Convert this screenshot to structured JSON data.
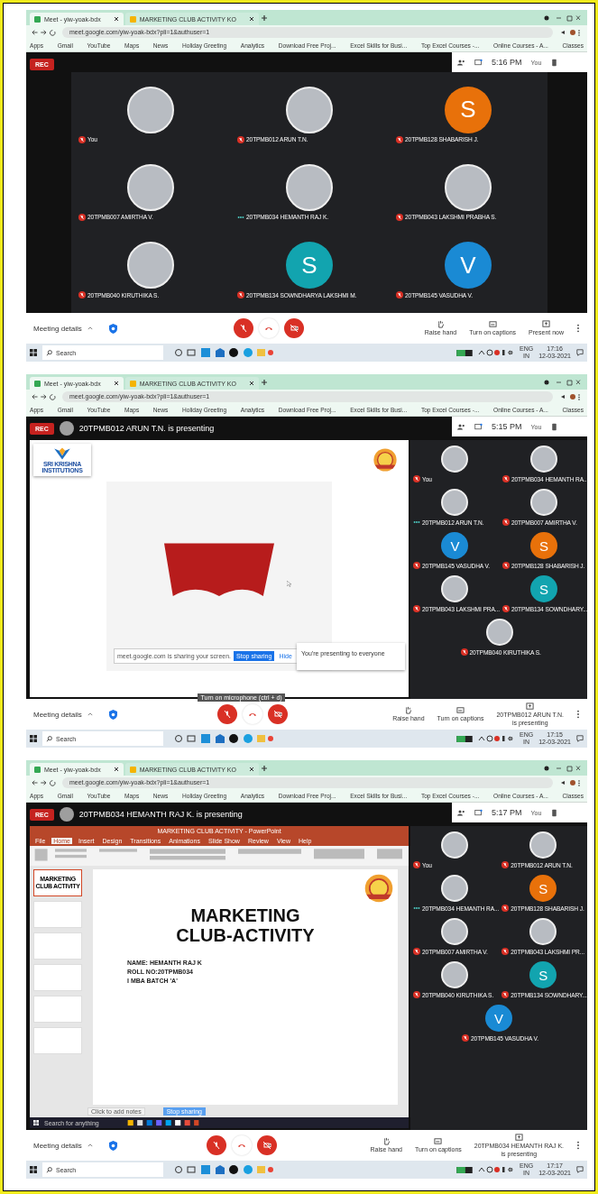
{
  "panels": [
    {
      "browser": {
        "tabs": [
          {
            "label": "Meet - yiw-yoak-bdx",
            "selected": true
          },
          {
            "label": "MARKETING CLUB ACTIVITY KO",
            "selected": false
          }
        ],
        "url": "meet.google.com/yiw-yoak-bdx?pli=1&authuser=1",
        "bookmarks": [
          "Apps",
          "Gmail",
          "YouTube",
          "Maps",
          "News",
          "Holiday Greeting",
          "Analytics",
          "Download Free Proj...",
          "Excel Skills for Busi...",
          "Top Excel Courses -...",
          "Online Courses - A...",
          "Classes"
        ]
      },
      "meeting": {
        "rec": "REC",
        "time": "5:16 PM",
        "you": "You",
        "tiles": [
          {
            "name": "You",
            "kind": "photo",
            "muted": true
          },
          {
            "name": "20TPMB012 ARUN T.N.",
            "kind": "photo",
            "muted": true
          },
          {
            "name": "20TPMB128 SHABARISH J.",
            "kind": "letter",
            "letter": "S",
            "color": "#e8710a",
            "muted": true
          },
          {
            "name": "20TPMB007 AMIRTHA V.",
            "kind": "photo",
            "muted": true
          },
          {
            "name": "20TPMB034 HEMANTH RAJ K.",
            "kind": "photo",
            "muted": false
          },
          {
            "name": "20TPMB043 LAKSHMI PRABHA S.",
            "kind": "photo",
            "muted": true
          },
          {
            "name": "20TPMB040 KIRUTHIKA S.",
            "kind": "photo",
            "muted": true
          },
          {
            "name": "20TPMB134 SOWNDHARYA LAKSHMI M.",
            "kind": "letter",
            "letter": "S",
            "color": "#12a4af",
            "muted": true
          },
          {
            "name": "20TPMB145 VASUDHA V.",
            "kind": "letter",
            "letter": "V",
            "color": "#1a8ad4",
            "muted": true
          }
        ]
      },
      "controls": {
        "details": "Meeting details",
        "raise": "Raise hand",
        "captions": "Turn on captions",
        "present": [
          "Present now"
        ]
      },
      "taskbar": {
        "search": "Search",
        "lang": "ENG",
        "region": "IN",
        "time": "17:16",
        "date": "12-03-2021"
      }
    },
    {
      "browser": {
        "tabs": [
          {
            "label": "Meet - yiw-yoak-bdx",
            "selected": true
          },
          {
            "label": "MARKETING CLUB ACTIVITY KO",
            "selected": false
          }
        ],
        "url": "meet.google.com/yiw-yoak-bdx?pli=1&authuser=1",
        "bookmarks": [
          "Apps",
          "Gmail",
          "YouTube",
          "Maps",
          "News",
          "Holiday Greeting",
          "Analytics",
          "Download Free Proj...",
          "Excel Skills for Busi...",
          "Top Excel Courses -...",
          "Online Courses - A...",
          "Classes"
        ]
      },
      "meeting": {
        "rec": "REC",
        "presenter": "20TPMB012 ARUN T.N. is presenting",
        "time": "5:15 PM",
        "you": "You",
        "stage": {
          "kind": "slide",
          "logo_lines": [
            "SRI KRISHNA",
            "INSTITUTIONS"
          ],
          "share_text": "meet.google.com is sharing your screen.",
          "stop": "Stop sharing",
          "hide": "Hide",
          "notice": "You're presenting to everyone"
        },
        "tooltip": "Turn on microphone (ctrl + d)",
        "tiles": [
          {
            "name": "You",
            "kind": "photo",
            "muted": true
          },
          {
            "name": "20TPMB034 HEMANTH RA...",
            "kind": "photo",
            "muted": true
          },
          {
            "name": "20TPMB012 ARUN T.N.",
            "kind": "photo",
            "muted": false
          },
          {
            "name": "20TPMB007 AMIRTHA V.",
            "kind": "photo",
            "muted": true
          },
          {
            "name": "20TPMB145 VASUDHA V.",
            "kind": "letter",
            "letter": "V",
            "color": "#1a8ad4",
            "muted": true
          },
          {
            "name": "20TPMB128 SHABARISH J.",
            "kind": "letter",
            "letter": "S",
            "color": "#e8710a",
            "muted": true
          },
          {
            "name": "20TPMB043 LAKSHMI PRA...",
            "kind": "photo",
            "muted": true
          },
          {
            "name": "20TPMB134 SOWNDHARY...",
            "kind": "letter",
            "letter": "S",
            "color": "#12a4af",
            "muted": true
          },
          {
            "name": "20TPMB040 KIRUTHIKA S.",
            "kind": "photo",
            "muted": true
          }
        ]
      },
      "controls": {
        "details": "Meeting details",
        "raise": "Raise hand",
        "captions": "Turn on captions",
        "present": [
          "20TPMB012 ARUN T.N.",
          "is presenting"
        ]
      },
      "taskbar": {
        "search": "Search",
        "lang": "ENG",
        "region": "IN",
        "time": "17:15",
        "date": "12-03-2021"
      }
    },
    {
      "browser": {
        "tabs": [
          {
            "label": "Meet - yiw-yoak-bdx",
            "selected": true
          },
          {
            "label": "MARKETING CLUB ACTIVITY KO",
            "selected": false
          }
        ],
        "url": "meet.google.com/yiw-yoak-bdx?pli=1&authuser=1",
        "bookmarks": [
          "Apps",
          "Gmail",
          "YouTube",
          "Maps",
          "News",
          "Holiday Greeting",
          "Analytics",
          "Download Free Proj...",
          "Excel Skills for Busi...",
          "Top Excel Courses -...",
          "Online Courses - A...",
          "Classes"
        ]
      },
      "meeting": {
        "rec": "REC",
        "presenter": "20TPMB034 HEMANTH RAJ K. is presenting",
        "time": "5:17 PM",
        "you": "You",
        "stage": {
          "kind": "powerpoint",
          "window_title": "MARKETING CLUB ACTIVITY - PowerPoint",
          "ribbon_tabs": [
            {
              "label": "File",
              "selected": false
            },
            {
              "label": "Home",
              "selected": true
            },
            {
              "label": "Insert",
              "selected": false
            },
            {
              "label": "Design",
              "selected": false
            },
            {
              "label": "Transitions",
              "selected": false
            },
            {
              "label": "Animations",
              "selected": false
            },
            {
              "label": "Slide Show",
              "selected": false
            },
            {
              "label": "Review",
              "selected": false
            },
            {
              "label": "View",
              "selected": false
            },
            {
              "label": "Help",
              "selected": false
            }
          ],
          "thumbnails": [
            {
              "title": "MARKETING CLUB ACTIVITY",
              "selected": true
            },
            {
              "selected": false
            },
            {
              "selected": false
            },
            {
              "selected": false
            },
            {
              "selected": false
            },
            {
              "selected": false
            }
          ],
          "title_lines": [
            "MARKETING",
            "CLUB-ACTIVITY"
          ],
          "details": [
            "NAME: HEMANTH RAJ K",
            "ROLL NO:20TPMB034",
            "I MBA BATCH 'A'"
          ],
          "notes": "Click to add notes",
          "stop": "Stop sharing",
          "inner_search": "Search for anything"
        },
        "tiles": [
          {
            "name": "You",
            "kind": "photo",
            "muted": true
          },
          {
            "name": "20TPMB012 ARUN T.N.",
            "kind": "photo",
            "muted": true
          },
          {
            "name": "20TPMB034 HEMANTH RA...",
            "kind": "photo",
            "muted": false
          },
          {
            "name": "20TPMB128 SHABARISH J.",
            "kind": "letter",
            "letter": "S",
            "color": "#e8710a",
            "muted": true
          },
          {
            "name": "20TPMB007 AMIRTHA V.",
            "kind": "photo",
            "muted": true
          },
          {
            "name": "20TPMB043 LAKSHMI PR...",
            "kind": "photo",
            "muted": true
          },
          {
            "name": "20TPMB040 KIRUTHIKA S.",
            "kind": "photo",
            "muted": true
          },
          {
            "name": "20TPMB134 SOWNDHARY...",
            "kind": "letter",
            "letter": "S",
            "color": "#12a4af",
            "muted": true
          },
          {
            "name": "20TPMB145 VASUDHA V.",
            "kind": "letter",
            "letter": "V",
            "color": "#1a8ad4",
            "muted": true
          }
        ]
      },
      "controls": {
        "details": "Meeting details",
        "raise": "Raise hand",
        "captions": "Turn on captions",
        "present": [
          "20TPMB034 HEMANTH RAJ K.",
          "is presenting"
        ]
      },
      "taskbar": {
        "search": "Search",
        "lang": "ENG",
        "region": "IN",
        "time": "17:17",
        "date": "12-03-2021"
      }
    }
  ]
}
